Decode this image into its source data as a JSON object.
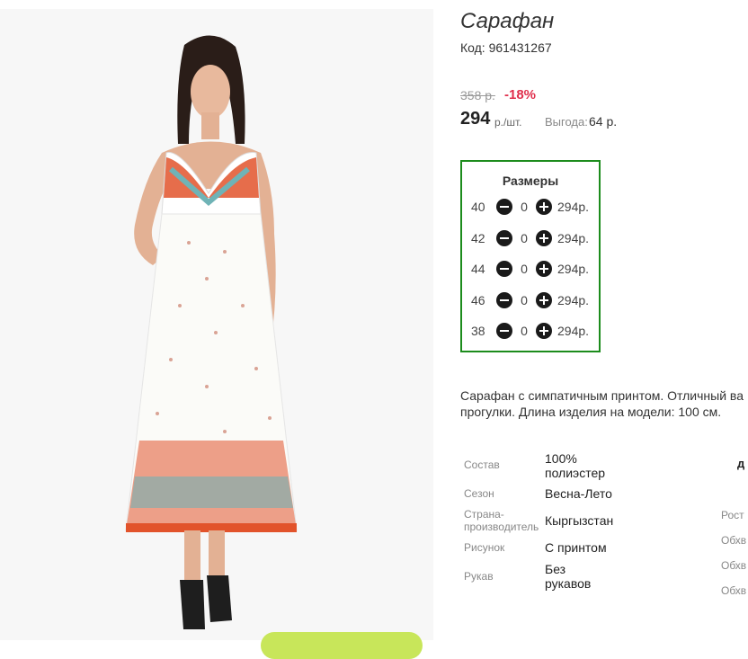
{
  "product": {
    "title": "Сарафан",
    "code": "Код: 961431267"
  },
  "pricing": {
    "old_price": "358 р.",
    "discount": "-18%",
    "price": "294",
    "unit": "р./шт.",
    "saving_label": "Выгода:",
    "saving_value": "64 р."
  },
  "sizes": {
    "title": "Размеры",
    "rows": [
      {
        "size": "40",
        "qty": "0",
        "price": "294р."
      },
      {
        "size": "42",
        "qty": "0",
        "price": "294р."
      },
      {
        "size": "44",
        "qty": "0",
        "price": "294р."
      },
      {
        "size": "46",
        "qty": "0",
        "price": "294р."
      },
      {
        "size": "38",
        "qty": "0",
        "price": "294р."
      }
    ]
  },
  "description": {
    "line1": "Сарафан с симпатичным принтом. Отличный ва",
    "line2": "прогулки. Длина изделия на модели: 100 см."
  },
  "attributes": [
    {
      "label": "Состав",
      "value_line1": "100%",
      "value_line2": "полиэстер"
    },
    {
      "label": "Сезон",
      "value_line1": "Весна-Лето",
      "value_line2": ""
    },
    {
      "label_line1": "Страна-",
      "label_line2": "производитель",
      "value_line1": "Кыргызстан",
      "value_line2": ""
    },
    {
      "label": "Рисунок",
      "value_line1": "С принтом",
      "value_line2": ""
    },
    {
      "label": "Рукав",
      "value_line1": "Без",
      "value_line2": "рукавов"
    }
  ],
  "right_column": {
    "top": "д",
    "labels": [
      "Рост",
      "Обхв",
      "Обхв",
      "Обхв"
    ]
  },
  "colors": {
    "accent_green": "#1c8c1c",
    "discount_red": "#e0304d",
    "button_green": "#c8e65a"
  }
}
